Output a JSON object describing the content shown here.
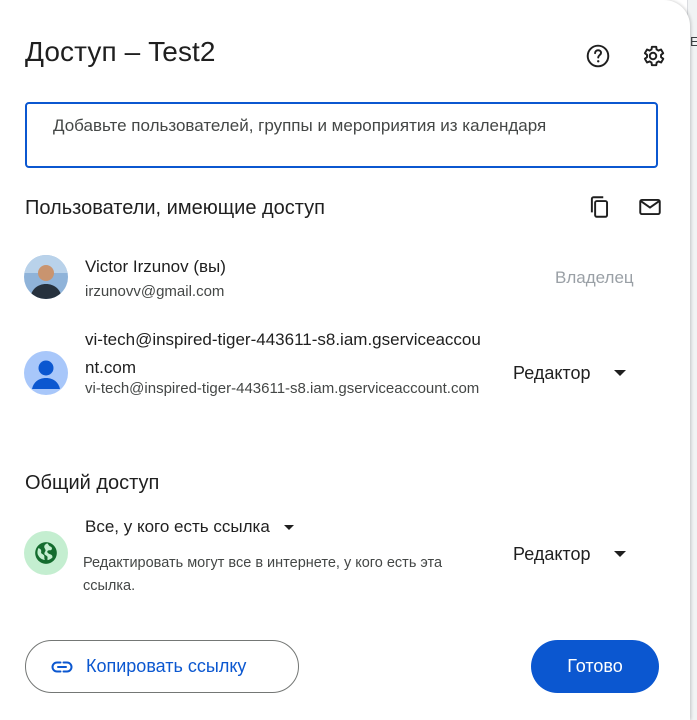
{
  "dialog": {
    "title": "Доступ – Test2"
  },
  "add_input": {
    "placeholder": "Добавьте пользователей, группы и мероприятия из календаря"
  },
  "users_section": {
    "title": "Пользователи, имеющие доступ",
    "users": [
      {
        "name": "Victor Irzunov (вы)",
        "email": "irzunovv@gmail.com",
        "role": "Владелец"
      },
      {
        "name": "vi-tech@inspired-tiger-443611-s8.iam.gserviceaccount.com",
        "email": "vi-tech@inspired-tiger-443611-s8.iam.gserviceaccount.com",
        "role": "Редактор"
      }
    ]
  },
  "general_access": {
    "title": "Общий доступ",
    "scope": "Все, у кого есть ссылка",
    "description": "Редактировать могут все в интернете, у кого есть эта ссылка.",
    "role": "Редактор"
  },
  "footer": {
    "copy_link_label": "Копировать ссылку",
    "done_label": "Готово"
  },
  "background": {
    "edge_letter": "E"
  },
  "colors": {
    "accent": "#0b57d0",
    "sa_avatar_bg": "#a8c7fa",
    "globe_bg": "#c4eed0",
    "globe_fg": "#146c2e"
  }
}
